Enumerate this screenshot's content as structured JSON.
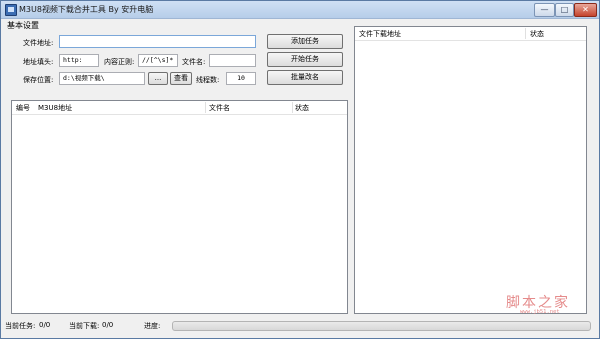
{
  "window": {
    "title": "M3U8视频下载合并工具 By 安升电脑",
    "buttons": {
      "minimize": "—",
      "maximize": "□",
      "close": "✕"
    }
  },
  "settings": {
    "group_title": "基本设置",
    "file_address_label": "文件地址:",
    "file_address_value": "",
    "address_prefix_label": "地址填头:",
    "address_prefix_value": "http:",
    "regex_label": "内容正则:",
    "regex_value": "//[^\\s]*",
    "file_name_label": "文件名:",
    "file_name_value": "",
    "save_location_label": "保存位置:",
    "save_location_value": "d:\\视频下载\\",
    "browse_label": "...",
    "view_label": "查看",
    "threads_label": "线程数:",
    "threads_value": "10"
  },
  "actions": {
    "add_task": "添加任务",
    "start_task": "开始任务",
    "batch_rename": "批量改名"
  },
  "task_list": {
    "columns": [
      "编号",
      "M3U8地址",
      "文件名",
      "状态"
    ],
    "rows": []
  },
  "download_list": {
    "columns": [
      "文件下载地址",
      "状态"
    ],
    "rows": []
  },
  "status": {
    "current_task_label": "当前任务:",
    "current_task_value": "0/0",
    "current_download_label": "当前下载:",
    "current_download_value": "0/0",
    "progress_label": "进度:",
    "progress_percent": 0
  },
  "watermark": {
    "text": "脚本之家",
    "url": "www.jb51.net"
  },
  "colors": {
    "title_bar": "#c4d7ef",
    "progress_fill": "#2ea52e",
    "watermark": "#e58b8b"
  }
}
